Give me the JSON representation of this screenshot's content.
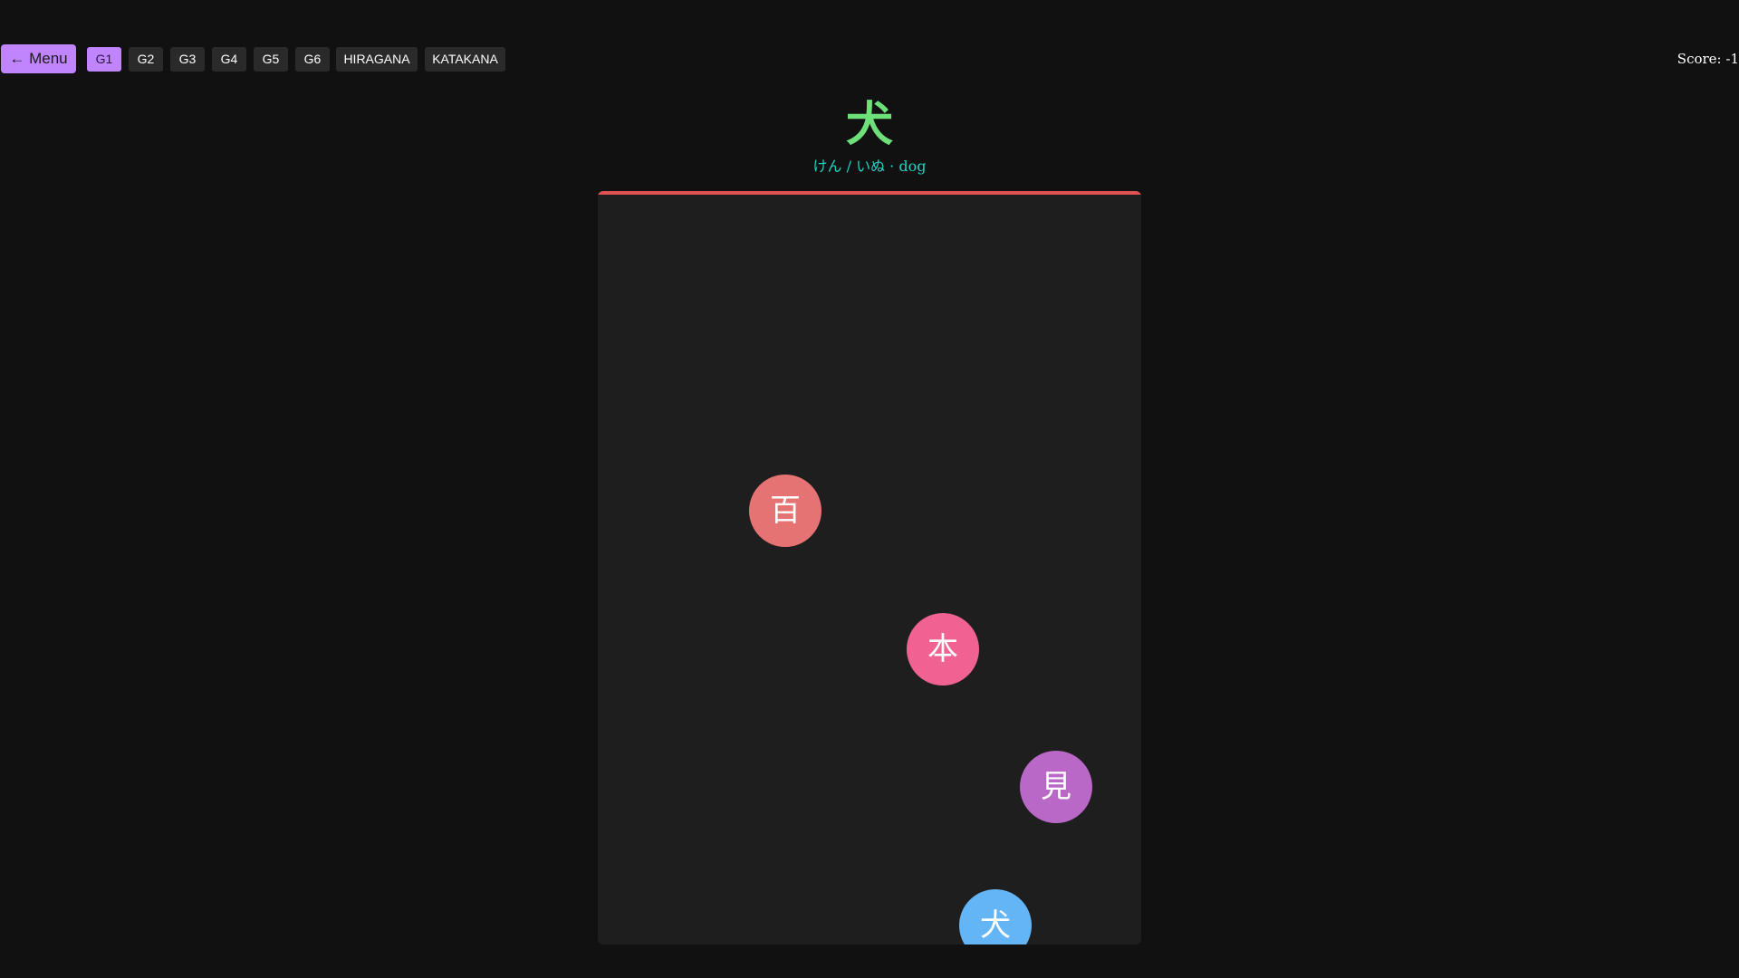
{
  "nav": {
    "menu_label": "← Menu",
    "grades": [
      {
        "label": "G1",
        "active": true
      },
      {
        "label": "G2",
        "active": false
      },
      {
        "label": "G3",
        "active": false
      },
      {
        "label": "G4",
        "active": false
      },
      {
        "label": "G5",
        "active": false
      },
      {
        "label": "G6",
        "active": false
      },
      {
        "label": "HIRAGANA",
        "active": false
      },
      {
        "label": "KATAKANA",
        "active": false
      }
    ],
    "score_text": "Score: -1"
  },
  "target": {
    "kanji": "犬",
    "reading": "けん / いぬ · dog"
  },
  "bubbles": [
    {
      "char": "百",
      "color": "#e57373"
    },
    {
      "char": "本",
      "color": "#f06292"
    },
    {
      "char": "見",
      "color": "#ba68c8"
    },
    {
      "char": "犬",
      "color": "#64b5f6"
    }
  ],
  "colors": {
    "accent": "#c084fc",
    "target_kanji": "#6ee07a",
    "reading": "#22d3c5",
    "danger_line": "#e05252"
  }
}
